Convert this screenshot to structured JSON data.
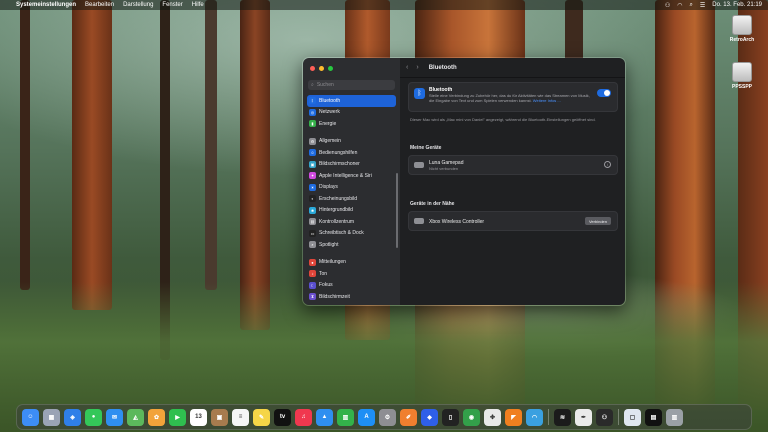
{
  "menubar": {
    "apple": "",
    "items": [
      "Systemeinstellungen",
      "Bearbeiten",
      "Darstellung",
      "Fenster",
      "Hilfe"
    ],
    "datetime": "Do. 13. Feb.  21:19"
  },
  "desktop": {
    "icons": [
      {
        "label": "RetroArch"
      },
      {
        "label": "PPSSPP"
      }
    ]
  },
  "window": {
    "search_placeholder": "Suchen",
    "sidebar": {
      "items": [
        {
          "label": "Bluetooth",
          "color": "#1e6be0",
          "glyph": "ᛒ"
        },
        {
          "label": "Netzwerk",
          "color": "#1e6be0",
          "glyph": "◎"
        },
        {
          "label": "Energie",
          "color": "#35b04a",
          "glyph": "▮"
        },
        {
          "label": "Allgemein",
          "color": "#8e8e93",
          "glyph": "⚙"
        },
        {
          "label": "Bedienungshilfen",
          "color": "#1e6be0",
          "glyph": "☺"
        },
        {
          "label": "Bildschirmschoner",
          "color": "#34a3c8",
          "glyph": "▣"
        },
        {
          "label": "Apple Intelligence & Siri",
          "color": "#d14be0",
          "glyph": "✦"
        },
        {
          "label": "Displays",
          "color": "#1e6be0",
          "glyph": "☀"
        },
        {
          "label": "Erscheinungsbild",
          "color": "#222222",
          "glyph": "◐"
        },
        {
          "label": "Hintergrundbild",
          "color": "#2aa8d8",
          "glyph": "❀"
        },
        {
          "label": "Kontrollzentrum",
          "color": "#8e8e93",
          "glyph": "▤"
        },
        {
          "label": "Schreibtisch & Dock",
          "color": "#222222",
          "glyph": "▭"
        },
        {
          "label": "Spotlight",
          "color": "#8e8e93",
          "glyph": "⌕"
        },
        {
          "label": "Mitteilungen",
          "color": "#e0453a",
          "glyph": "●"
        },
        {
          "label": "Ton",
          "color": "#e0453a",
          "glyph": "♪"
        },
        {
          "label": "Fokus",
          "color": "#5a4fcf",
          "glyph": "☾"
        },
        {
          "label": "Bildschirmzeit",
          "color": "#6a4fcf",
          "glyph": "⧗"
        }
      ]
    },
    "toolbar": {
      "title": "Bluetooth"
    },
    "bluetooth": {
      "title": "Bluetooth",
      "description": "Stelle eine Verbindung zu Zubehör her, das du für Aktivitäten wie das Streamen von Musik, die Eingabe von Text und zum Spielen verwenden kannst.",
      "link": "Weitere Infos ...",
      "enabled": true
    },
    "note": "Dieser Mac wird als „Mac mini von Daniel\" angezeigt, während die Bluetooth-Einstellungen geöffnet sind.",
    "my_devices": {
      "heading": "Meine Geräte",
      "devices": [
        {
          "name": "Luna Gamepad",
          "status": "Nicht verbunden"
        }
      ]
    },
    "nearby": {
      "heading": "Geräte in der Nähe",
      "devices": [
        {
          "name": "Xbox Wireless Controller",
          "action": "Verbinden"
        }
      ]
    },
    "help": "?"
  },
  "dock": {
    "apps": [
      {
        "name": "finder",
        "color": "#3d8df5",
        "glyph": "☺"
      },
      {
        "name": "launchpad",
        "color": "#9aa3b5",
        "glyph": "▦"
      },
      {
        "name": "safari",
        "color": "#2f7fe8",
        "glyph": "◈"
      },
      {
        "name": "messages",
        "color": "#34c759",
        "glyph": "●"
      },
      {
        "name": "mail",
        "color": "#2f8ff0",
        "glyph": "✉"
      },
      {
        "name": "maps",
        "color": "#5cb85c",
        "glyph": "◭"
      },
      {
        "name": "photos",
        "color": "#f2a33a",
        "glyph": "✿"
      },
      {
        "name": "facetime",
        "color": "#2fbf4f",
        "glyph": "▶"
      },
      {
        "name": "calendar",
        "color": "#ffffff",
        "glyph": "13"
      },
      {
        "name": "notes-brown",
        "color": "#a77b4e",
        "glyph": "▣"
      },
      {
        "name": "reminders",
        "color": "#f5f5f5",
        "glyph": "≡"
      },
      {
        "name": "notes",
        "color": "#f5d547",
        "glyph": "✎"
      },
      {
        "name": "apple-tv",
        "color": "#111111",
        "glyph": "tv"
      },
      {
        "name": "music",
        "color": "#f0384f",
        "glyph": "♫"
      },
      {
        "name": "keynote",
        "color": "#2f8ff0",
        "glyph": "▲"
      },
      {
        "name": "numbers",
        "color": "#33b24a",
        "glyph": "▥"
      },
      {
        "name": "app-store",
        "color": "#1e8ff5",
        "glyph": "A"
      },
      {
        "name": "system-settings",
        "color": "#8e8e93",
        "glyph": "⚙"
      },
      {
        "name": "pages",
        "color": "#f07f2f",
        "glyph": "✐"
      },
      {
        "name": "xcode-blue",
        "color": "#2f5fe8",
        "glyph": "◆"
      },
      {
        "name": "iphone-mirroring",
        "color": "#222222",
        "glyph": "▯"
      },
      {
        "name": "gpu-app",
        "color": "#33a04a",
        "glyph": "◉"
      },
      {
        "name": "game-center",
        "color": "#e8e8e8",
        "glyph": "✤"
      },
      {
        "name": "fox-app",
        "color": "#f07f1f",
        "glyph": "◤"
      },
      {
        "name": "vpn-app",
        "color": "#3aa0e0",
        "glyph": "◠"
      },
      {
        "name": "audio-app",
        "color": "#1b1b1b",
        "glyph": "≋"
      },
      {
        "name": "pen-app",
        "color": "#eaeaea",
        "glyph": "✒"
      },
      {
        "name": "gamepad-app",
        "color": "#2a2a2a",
        "glyph": "⚇"
      },
      {
        "name": "preview",
        "color": "#dfe6f0",
        "glyph": "▢"
      },
      {
        "name": "dashboard",
        "color": "#111111",
        "glyph": "▤"
      },
      {
        "name": "trash",
        "color": "#9aa0a6",
        "glyph": "▥"
      }
    ]
  }
}
